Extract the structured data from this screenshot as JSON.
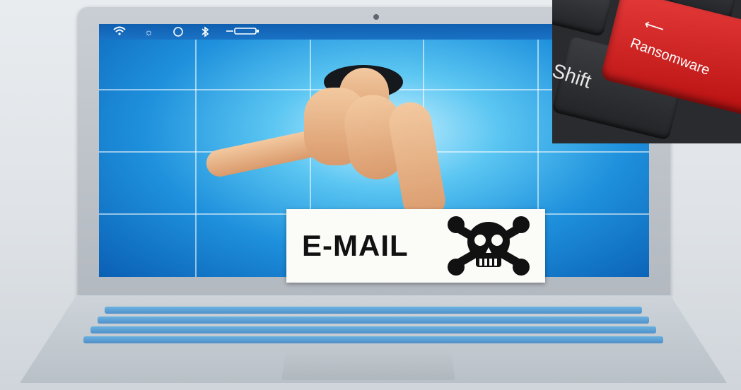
{
  "scene": {
    "email_label": "E-MAIL",
    "inset": {
      "ransomware_key_label": "Ransomware",
      "shift_key_label": "Shift"
    },
    "status_icons": [
      "wifi-icon",
      "brightness-icon",
      "compass-icon",
      "bluetooth-icon",
      "battery-icon"
    ],
    "colors": {
      "screen_blue": "#1e90dc",
      "ransomware_red": "#d21e1e",
      "keyboard_dark": "#2a2b2e"
    }
  }
}
